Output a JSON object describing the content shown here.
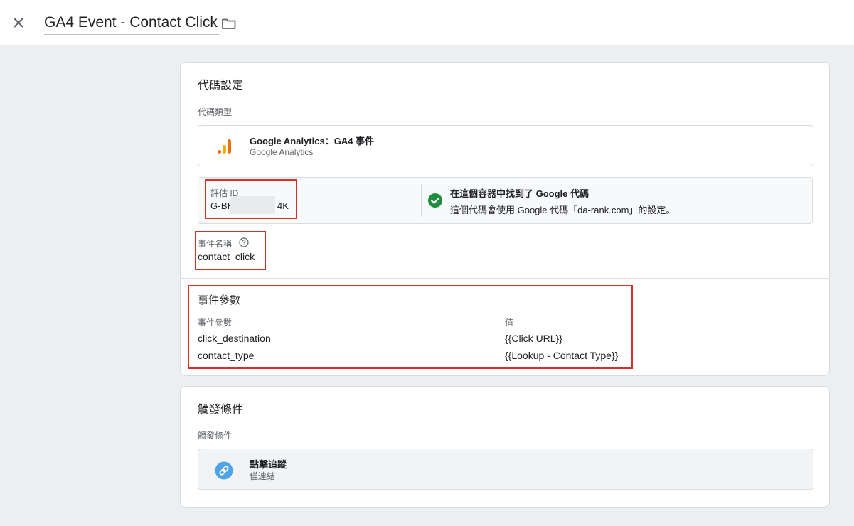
{
  "header": {
    "title": "GA4 Event - Contact Click",
    "close_icon": "close-icon",
    "folder_icon": "folder-icon"
  },
  "tag_config": {
    "title": "代碼設定",
    "tag_type_label": "代碼類型",
    "tag_type": {
      "name": "Google Analytics：GA4 事件",
      "subtitle": "Google Analytics",
      "icon": "google-analytics-icon"
    },
    "measurement_id": {
      "label": "評估 ID",
      "prefix": "G-BH",
      "suffix": "4K"
    },
    "google_tag_found": {
      "title": "在這個容器中找到了 Google 代碼",
      "subtitle": "這個代碼會使用 Google 代碼「da-rank.com」的設定。",
      "icon": "check-circle-icon"
    },
    "event_name": {
      "label": "事件名稱",
      "value": "contact_click",
      "help_icon": "help-icon"
    },
    "event_params": {
      "title": "事件參數",
      "col_param": "事件參數",
      "col_value": "值",
      "rows": [
        {
          "param": "click_destination",
          "value": "{{Click URL}}"
        },
        {
          "param": "contact_type",
          "value": "{{Lookup - Contact Type}}"
        }
      ]
    }
  },
  "triggering": {
    "title": "觸發條件",
    "label": "觸發條件",
    "trigger": {
      "name": "點擊追蹤",
      "subtitle": "僅連結",
      "icon": "link-icon"
    }
  },
  "colors": {
    "highlight_red": "#d93025",
    "check_green": "#1e8e3e",
    "link_blue": "#4fa3e8",
    "ga_orange": "#e8710a",
    "ga_yellow": "#f9ab00"
  }
}
